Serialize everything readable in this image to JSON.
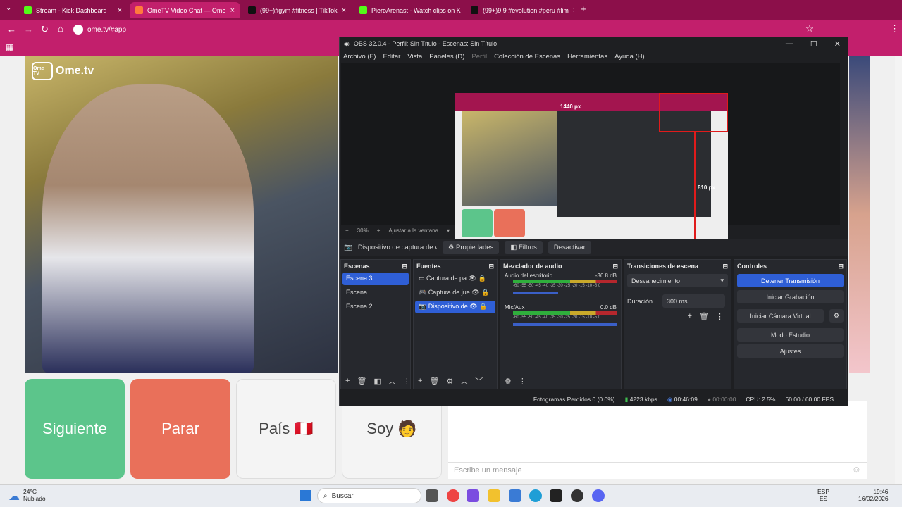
{
  "browser": {
    "tabs": [
      {
        "label": "Stream - Kick Dashboard",
        "color": "#53fc18"
      },
      {
        "label": "OmeTV Video Chat — Ome",
        "color": "#ff7a3d"
      },
      {
        "label": "(99+)#gym #fitness | TikTok",
        "color": "#111111"
      },
      {
        "label": "PieroArenast - Watch clips on K",
        "color": "#53fc18"
      },
      {
        "label": "(99+)9:9 #evolution #peru #lim",
        "color": "#111111"
      }
    ],
    "url": "ome.tv/#app"
  },
  "ome": {
    "logo": "Ome.tv",
    "logo_small": "Ome TV",
    "buttons": {
      "next": "Siguiente",
      "stop": "Parar",
      "country": "País 🇵🇪",
      "me": "Soy 🧑"
    },
    "chat_placeholder": "Escribe un mensaje"
  },
  "obs": {
    "title": "OBS 32.0.4 - Perfil: Sin Título - Escenas: Sin Título",
    "menu": [
      "Archivo (F)",
      "Editar",
      "Vista",
      "Paneles (D)",
      "Perfil",
      "Colección de Escenas",
      "Herramientas",
      "Ayuda (H)"
    ],
    "preview": {
      "w_label": "1440 px",
      "h_label": "810 px"
    },
    "zoom": "30%",
    "fit": "Ajustar a la ventana",
    "source_bar": {
      "name": "Dispositivo de captura de v",
      "props": "Propiedades",
      "filters": "Filtros",
      "disable": "Desactivar"
    },
    "docks": {
      "scenes": {
        "title": "Escenas",
        "items": [
          "Escena 3",
          "Escena",
          "Escena 2"
        ]
      },
      "sources": {
        "title": "Fuentes",
        "items": [
          "Captura de pa",
          "Captura de jue",
          "Dispositivo de"
        ]
      },
      "mixer": {
        "title": "Mezclador de audio",
        "ch1": "Audio del escritorio",
        "ch1_db": "-36.8 dB",
        "ch2": "Mic/Aux",
        "ch2_db": "0.0 dB",
        "scale": "-60 -55 -50 -45 -40 -35 -30 -25 -20 -15 -10 -5 0"
      },
      "transitions": {
        "title": "Transiciones de escena",
        "type": "Desvanecimiento",
        "dur_label": "Duración",
        "duration": "300 ms"
      },
      "controls": {
        "title": "Controles",
        "stream": "Detener Transmisión",
        "record": "Iniciar Grabación",
        "vcam": "Iniciar Cámara Virtual",
        "studio": "Modo Estudio",
        "settings": "Ajustes"
      }
    },
    "status": {
      "dropped": "Fotogramas Perdidos 0 (0.0%)",
      "bitrate": "4223 kbps",
      "live": "00:46:09",
      "rec": "00:00:00",
      "cpu": "CPU: 2.5%",
      "fps": "60.00 / 60.00 FPS"
    }
  },
  "taskbar": {
    "weather_temp": "24°C",
    "weather_desc": "Nublado",
    "search": "Buscar",
    "lang1": "ESP",
    "lang2": "ES",
    "time": "19:46",
    "date": "16/02/2026"
  }
}
